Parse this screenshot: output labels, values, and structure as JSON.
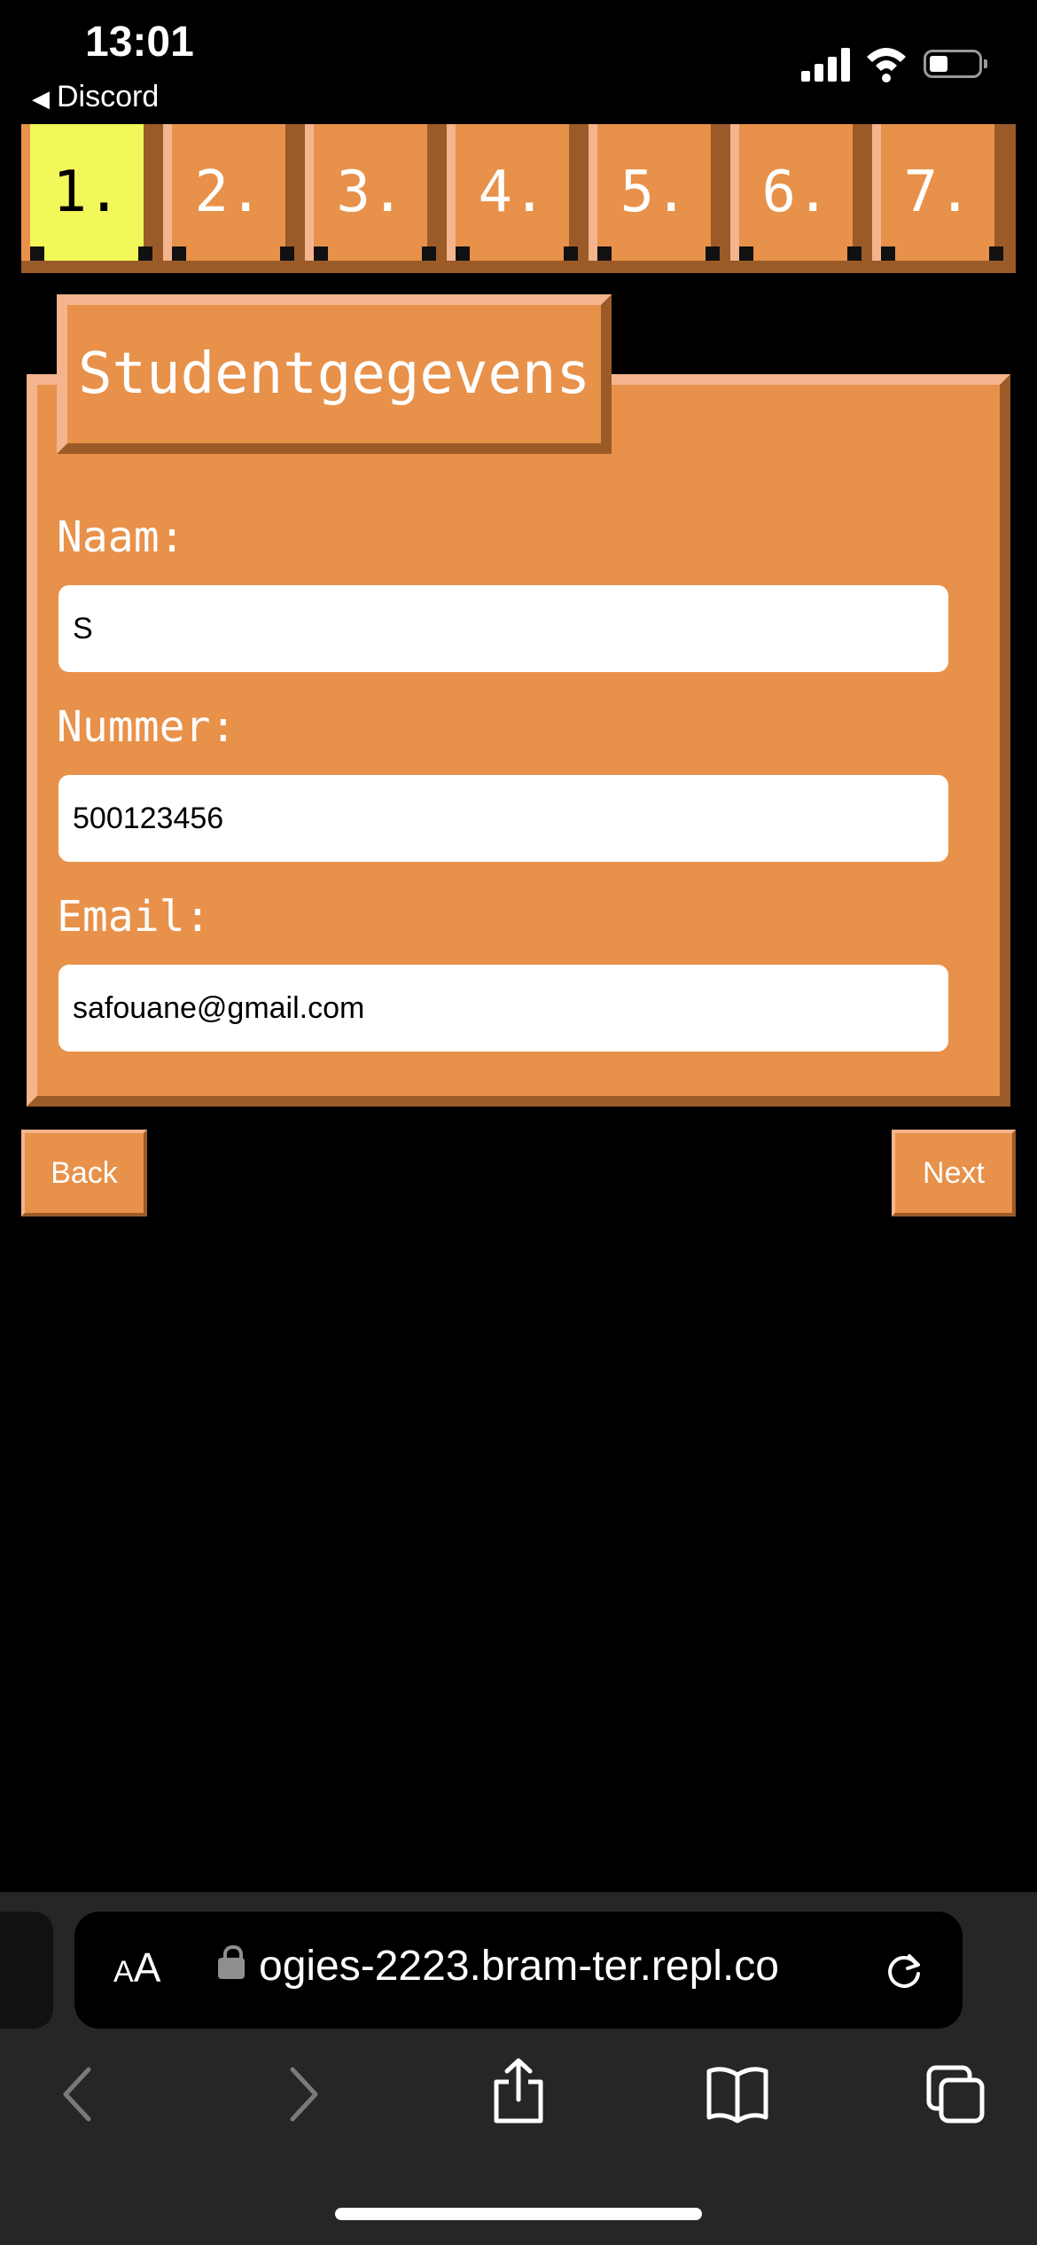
{
  "status": {
    "time": "13:01",
    "back_app": "Discord",
    "back_glyph": "◀"
  },
  "steps": [
    {
      "label": "1.",
      "active": true
    },
    {
      "label": "2.",
      "active": false
    },
    {
      "label": "3.",
      "active": false
    },
    {
      "label": "4.",
      "active": false
    },
    {
      "label": "5.",
      "active": false
    },
    {
      "label": "6.",
      "active": false
    },
    {
      "label": "7.",
      "active": false
    }
  ],
  "card": {
    "title": "Studentgegevens"
  },
  "form": {
    "name_label": "Naam:",
    "name_value": "S",
    "number_label": "Nummer:",
    "number_value": "500123456",
    "email_label": "Email:",
    "email_value": "safouane@gmail.com"
  },
  "nav": {
    "back_label": "Back",
    "next_label": "Next"
  },
  "browser": {
    "aa_small": "A",
    "aa_big": "A",
    "url": "ogies-2223.bram-ter.repl.co",
    "toolbar_icons": [
      "back-arrow-icon",
      "forward-arrow-icon",
      "share-icon",
      "bookmarks-icon",
      "tabs-icon"
    ]
  },
  "colors": {
    "accent": "#e8914a",
    "highlight": "#f4b48d",
    "shadow": "#9b5b28",
    "active_step": "#f2f75a"
  }
}
